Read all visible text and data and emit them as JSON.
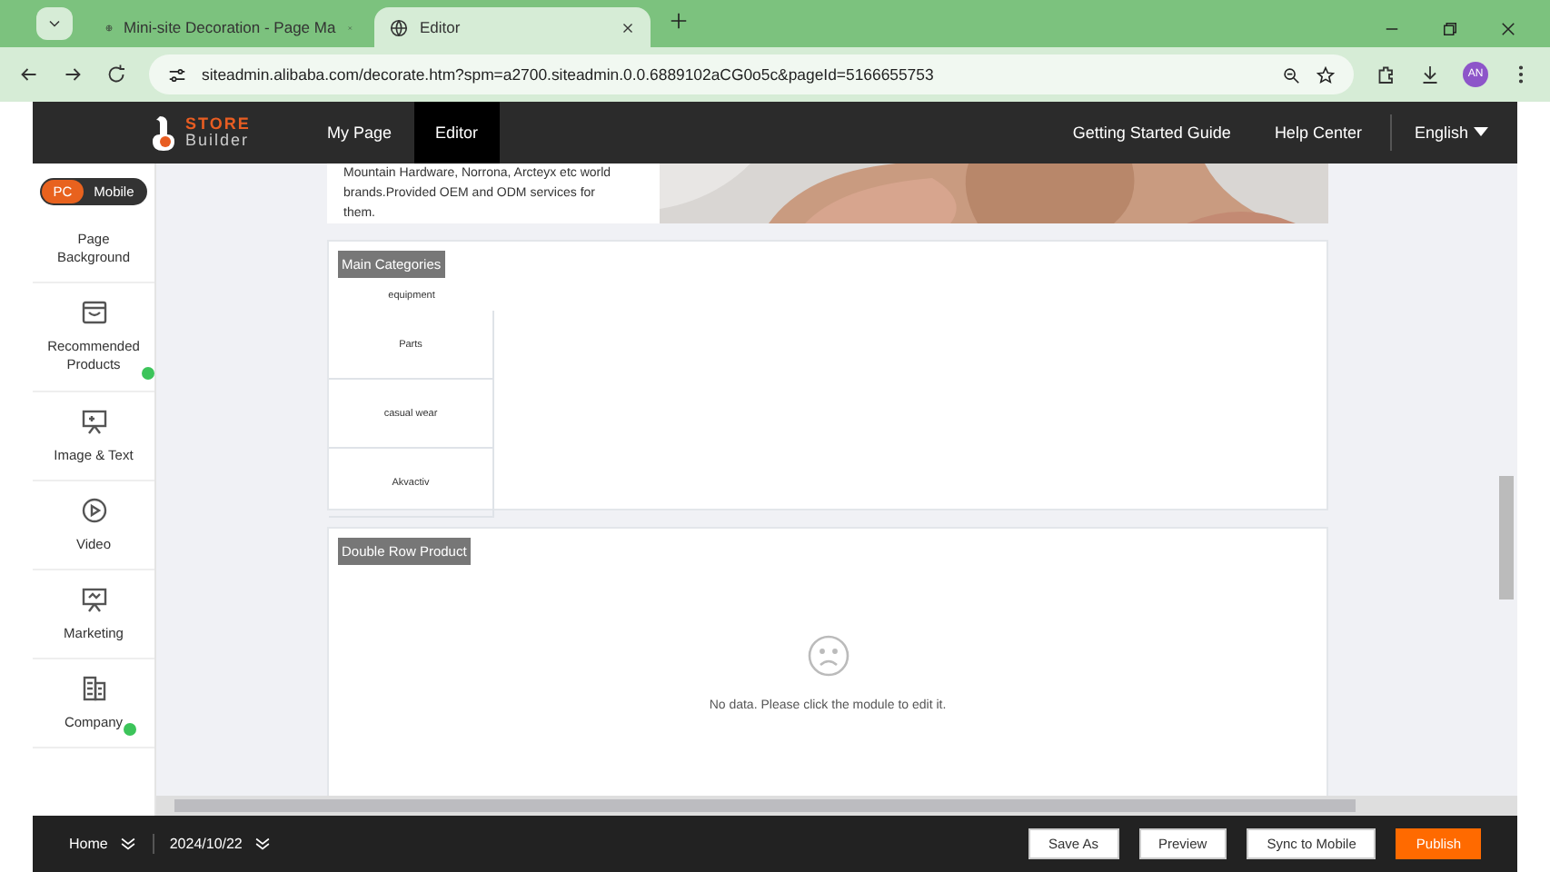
{
  "browser": {
    "tabs": [
      {
        "title": "Mini-site Decoration - Page Ma",
        "selected": false
      },
      {
        "title": "Editor",
        "selected": true
      }
    ],
    "address": "siteadmin.alibaba.com/decorate.htm?spm=a2700.siteadmin.0.0.6889102aCG0o5c&pageId=5166655753",
    "profile": "AN"
  },
  "header": {
    "logo_top": "STORE",
    "logo_bottom": "Builder",
    "nav": [
      {
        "label": "My Page",
        "selected": false
      },
      {
        "label": "Editor",
        "selected": true
      }
    ],
    "links": [
      "Getting Started Guide",
      "Help Center"
    ],
    "language": "English"
  },
  "sidebar": {
    "toggle": [
      {
        "label": "PC",
        "selected": true
      },
      {
        "label": "Mobile",
        "selected": false
      }
    ],
    "items": [
      {
        "label": "Page Background",
        "kind": "plain",
        "badge": false
      },
      {
        "label": "Recommended Products",
        "kind": "products",
        "badge": true
      },
      {
        "label": "Image & Text",
        "kind": "image-text",
        "badge": false
      },
      {
        "label": "Video",
        "kind": "video",
        "badge": false
      },
      {
        "label": "Marketing",
        "kind": "marketing",
        "badge": false
      },
      {
        "label": "Company",
        "kind": "company",
        "badge": true
      }
    ]
  },
  "canvas": {
    "intro_text": "Mountain Hardware, Norrona, Arcteyx etc world brands.Provided OEM and ODM services for them.",
    "main_categories": {
      "title": "Main Categories",
      "items": [
        "equipment",
        "Parts",
        "casual wear",
        "Akvactiv"
      ]
    },
    "double_row": {
      "title": "Double Row Product",
      "empty_message": "No data. Please click the module to edit it."
    }
  },
  "footer": {
    "page": "Home",
    "date": "2024/10/22",
    "buttons": [
      {
        "label": "Save As",
        "kind": "plain"
      },
      {
        "label": "Preview",
        "kind": "plain"
      },
      {
        "label": "Sync to Mobile",
        "kind": "plain"
      },
      {
        "label": "Publish",
        "kind": "primary"
      }
    ]
  }
}
